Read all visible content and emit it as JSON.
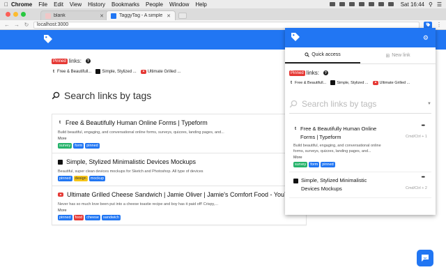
{
  "menubar": {
    "app": "Chrome",
    "items": [
      "File",
      "Edit",
      "View",
      "History",
      "Bookmarks",
      "People",
      "Window",
      "Help"
    ],
    "clock": "Sat 16:44"
  },
  "tabs": [
    {
      "title": "blank"
    },
    {
      "title": "TaggyTag - A simple bookmark"
    }
  ],
  "address": {
    "url": "localhost:3000"
  },
  "main": {
    "pinned_badge": "Pinned",
    "pinned_suffix": "links:",
    "help": "?",
    "pinned_links": [
      "Free & Beautifull...",
      "Simple, Stylized ...",
      "Ultimate Grilled ..."
    ],
    "search_placeholder": "Search links by tags",
    "cards": [
      {
        "title": "Free & Beautifully Human Online Forms | Typeform",
        "desc": "Build beautiful, engaging, and conversational online forms, surveys, quizzes, landing pages, and...",
        "more": "More",
        "tags": [
          "survey",
          "form",
          "pinned"
        ]
      },
      {
        "title": "Simple, Stylized Minimalistic Devices Mockups",
        "desc": "Beautiful, super clean devices mockups for Sketch and Photoshop. All type of devices",
        "more": "",
        "tags": [
          "pinned",
          "design",
          "mockup"
        ]
      },
      {
        "title": "Ultimate Grilled Cheese Sandwich | Jamie Oliver | Jamie's Comfort Food - YouTube",
        "desc": "Never has so much love been put into a cheese toastie recipe and boy has it paid off! Crispy,...",
        "more": "More",
        "tags": [
          "pinned",
          "food",
          "cheese",
          "sandwich"
        ]
      }
    ]
  },
  "popup": {
    "tabs": [
      {
        "label": "Quick access"
      },
      {
        "label": "New link"
      }
    ],
    "pinned_badge": "Pinned",
    "pinned_suffix": "links:",
    "help": "?",
    "pinned_links": [
      "Free & Beautifull...",
      "Simple, Stylized ...",
      "Ultimate Grilled ..."
    ],
    "search_placeholder": "Search links by tags",
    "cards": [
      {
        "title": "Free & Beautifully Human Online Forms | Typeform",
        "desc": "Build beautiful, engaging, and conversational online forms, surveys, quizzes, landing pages, and...",
        "more": "More",
        "tags": [
          "survey",
          "form",
          "pinned"
        ],
        "shortcut": "Cmd/Ctrl + 1",
        "dots": "•••"
      },
      {
        "title": "Simple, Stylized Minimalistic Devices Mockups",
        "shortcut": "Cmd/Ctrl + 2",
        "dots": "•••"
      }
    ]
  },
  "colors": {
    "brand": "#2176f3",
    "pinned": "#e53935",
    "tag_green": "#26b36b",
    "tag_blue": "#2176f3",
    "tag_yellow": "#f5c518",
    "tag_red": "#e53935"
  }
}
